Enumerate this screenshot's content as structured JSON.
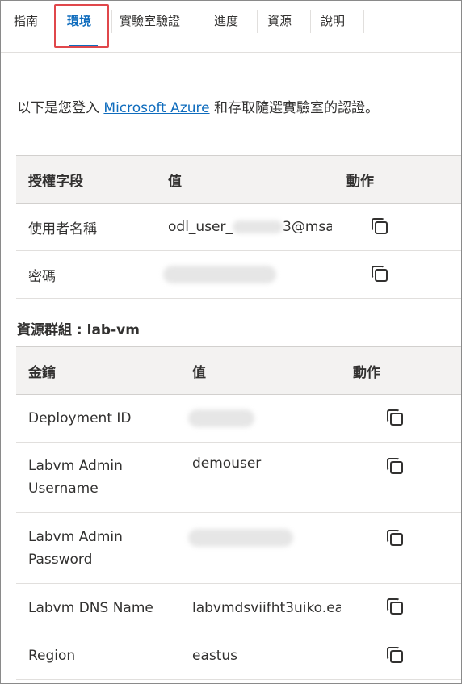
{
  "tabs": [
    {
      "label": "指南"
    },
    {
      "label": "環境"
    },
    {
      "label": "實驗室驗證"
    },
    {
      "label": "進度"
    },
    {
      "label": "資源"
    },
    {
      "label": "說明"
    }
  ],
  "active_tab": "環境",
  "intro": {
    "before": "以下是您登入 ",
    "link": "Microsoft Azure",
    "after": " 和存取隨選實驗室的認證。"
  },
  "cred_table": {
    "headers": [
      "授權字段",
      "值",
      "動作"
    ],
    "rows": [
      {
        "field": "使用者名稱",
        "value_prefix": "odl_user_",
        "value_suffix": "3@msa"
      },
      {
        "field": "密碼",
        "value": ""
      }
    ]
  },
  "resource_group": "資源群組 : lab-vm",
  "rg_table": {
    "headers": [
      "金鑰",
      "值",
      "動作"
    ],
    "rows": [
      {
        "key": "Deployment ID",
        "value": ""
      },
      {
        "key": "Labvm Admin Username",
        "value": "demouser"
      },
      {
        "key": "Labvm Admin Password",
        "value": ""
      },
      {
        "key": "Labvm DNS Name",
        "value": "labvmdsviifht3uiko.ea"
      },
      {
        "key": "Region",
        "value": "eastus"
      }
    ]
  },
  "icons": {
    "copy": "copy-icon"
  },
  "colors": {
    "accent": "#0f6cbd",
    "highlight": "#e0474b",
    "header_bg": "#f3f2f1"
  }
}
